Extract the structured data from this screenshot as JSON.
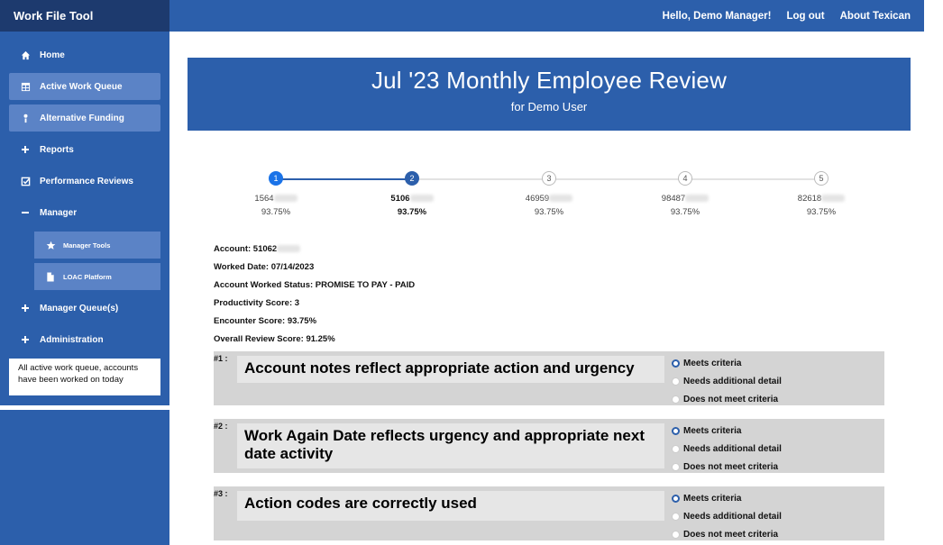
{
  "app": {
    "title": "Work File Tool"
  },
  "topnav": {
    "greeting": "Hello, Demo Manager!",
    "logout": "Log out",
    "about": "About Texican"
  },
  "sidebar": {
    "items": [
      {
        "label": "Home",
        "icon": "home-icon"
      },
      {
        "label": "Active Work Queue",
        "icon": "table-icon"
      },
      {
        "label": "Alternative Funding",
        "icon": "alert-icon"
      },
      {
        "label": "Reports",
        "icon": "plus-icon"
      },
      {
        "label": "Performance Reviews",
        "icon": "checkbox-icon"
      },
      {
        "label": "Manager",
        "icon": "minus-icon"
      },
      {
        "label": "Manager Tools",
        "icon": "star-icon"
      },
      {
        "label": "LOAC Platform",
        "icon": "file-icon"
      },
      {
        "label": "Manager Queue(s)",
        "icon": "plus-icon"
      },
      {
        "label": "Administration",
        "icon": "plus-icon"
      }
    ],
    "info": "All active work queue, accounts have been worked on today"
  },
  "banner": {
    "title": "Jul '23 Monthly Employee Review",
    "subtitle": "for Demo User"
  },
  "steps": [
    {
      "num": "1",
      "account": "1564",
      "score": "93.75%"
    },
    {
      "num": "2",
      "account": "5106",
      "score": "93.75%"
    },
    {
      "num": "3",
      "account": "46959",
      "score": "93.75%"
    },
    {
      "num": "4",
      "account": "98487",
      "score": "93.75%"
    },
    {
      "num": "5",
      "account": "82618",
      "score": "93.75%"
    }
  ],
  "details": {
    "account": "Account:  51062",
    "worked_date": "Worked Date: 07/14/2023",
    "status": "Account Worked Status: PROMISE TO PAY - PAID",
    "productivity": "Productivity Score: 3",
    "encounter": "Encounter Score: 93.75%",
    "overall": "Overall Review Score: 91.25%"
  },
  "criteria": [
    {
      "num": "#1 :",
      "text": "Account notes reflect appropriate action and urgency",
      "options": [
        "Meets criteria",
        "Needs additional detail",
        "Does not meet criteria"
      ],
      "selected": "Meets criteria"
    },
    {
      "num": "#2 :",
      "text": "Work Again Date reflects urgency and appropriate next date activity",
      "options": [
        "Meets criteria",
        "Needs additional detail",
        "Does not meet criteria"
      ],
      "selected": "Meets criteria"
    },
    {
      "num": "#3 :",
      "text": "Action codes are correctly used",
      "options": [
        "Meets criteria",
        "Needs additional detail",
        "Does not meet criteria"
      ],
      "selected": "Meets criteria"
    }
  ],
  "colors": {
    "primary": "#2c5fab",
    "dark": "#1d3a6e",
    "accent": "#1a73e8",
    "panel": "#d4d4d4"
  }
}
